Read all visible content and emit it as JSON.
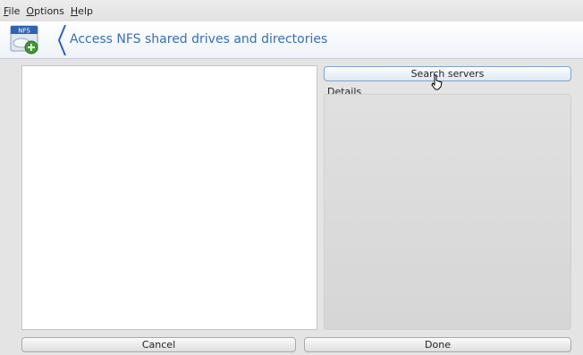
{
  "menubar": {
    "items": [
      {
        "mnemonic": "F",
        "rest": "ile"
      },
      {
        "mnemonic": "O",
        "rest": "ptions"
      },
      {
        "mnemonic": "H",
        "rest": "elp"
      }
    ]
  },
  "banner": {
    "title": "Access NFS shared drives and directories",
    "icon_text": "NFS",
    "icon": "nfs-add-icon"
  },
  "actions": {
    "search_label": "Search servers",
    "cancel_label": "Cancel",
    "done_label": "Done"
  },
  "details": {
    "label": "Details"
  },
  "colors": {
    "accent": "#3a6fb0",
    "window_bg": "#e4e4e4"
  }
}
